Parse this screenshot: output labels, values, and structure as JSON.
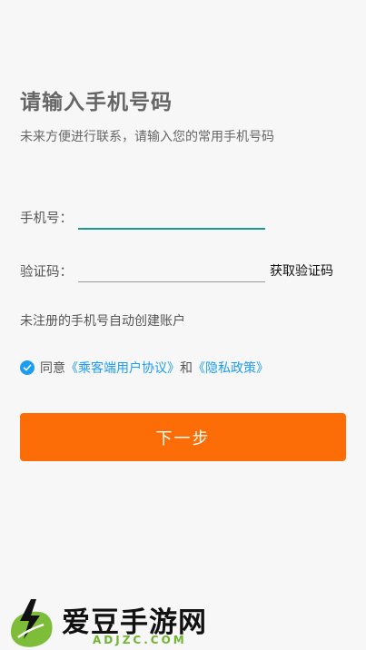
{
  "header": {
    "title": "请输入手机号码",
    "subtitle": "未来方便进行联系，请输入您的常用手机号码"
  },
  "form": {
    "phone_label": "手机号：",
    "phone_value": "",
    "code_label": "验证码：",
    "code_value": "",
    "get_code_label": "获取验证码",
    "accent_color": "#1a9a8a"
  },
  "note": "未注册的手机号自动创建账户",
  "agreement": {
    "checked": true,
    "prefix": "同意",
    "user_agreement": "《乘客端用户协议》",
    "connector": "和",
    "privacy_policy": "《隐私政策》",
    "link_color": "#1e9df0"
  },
  "next_button": {
    "label": "下一步",
    "color": "#fd6d07"
  },
  "watermark": {
    "logo_icon": "lightning-leaf-icon",
    "text": "爱豆手游网",
    "subtext": "ADJZC.COM"
  }
}
